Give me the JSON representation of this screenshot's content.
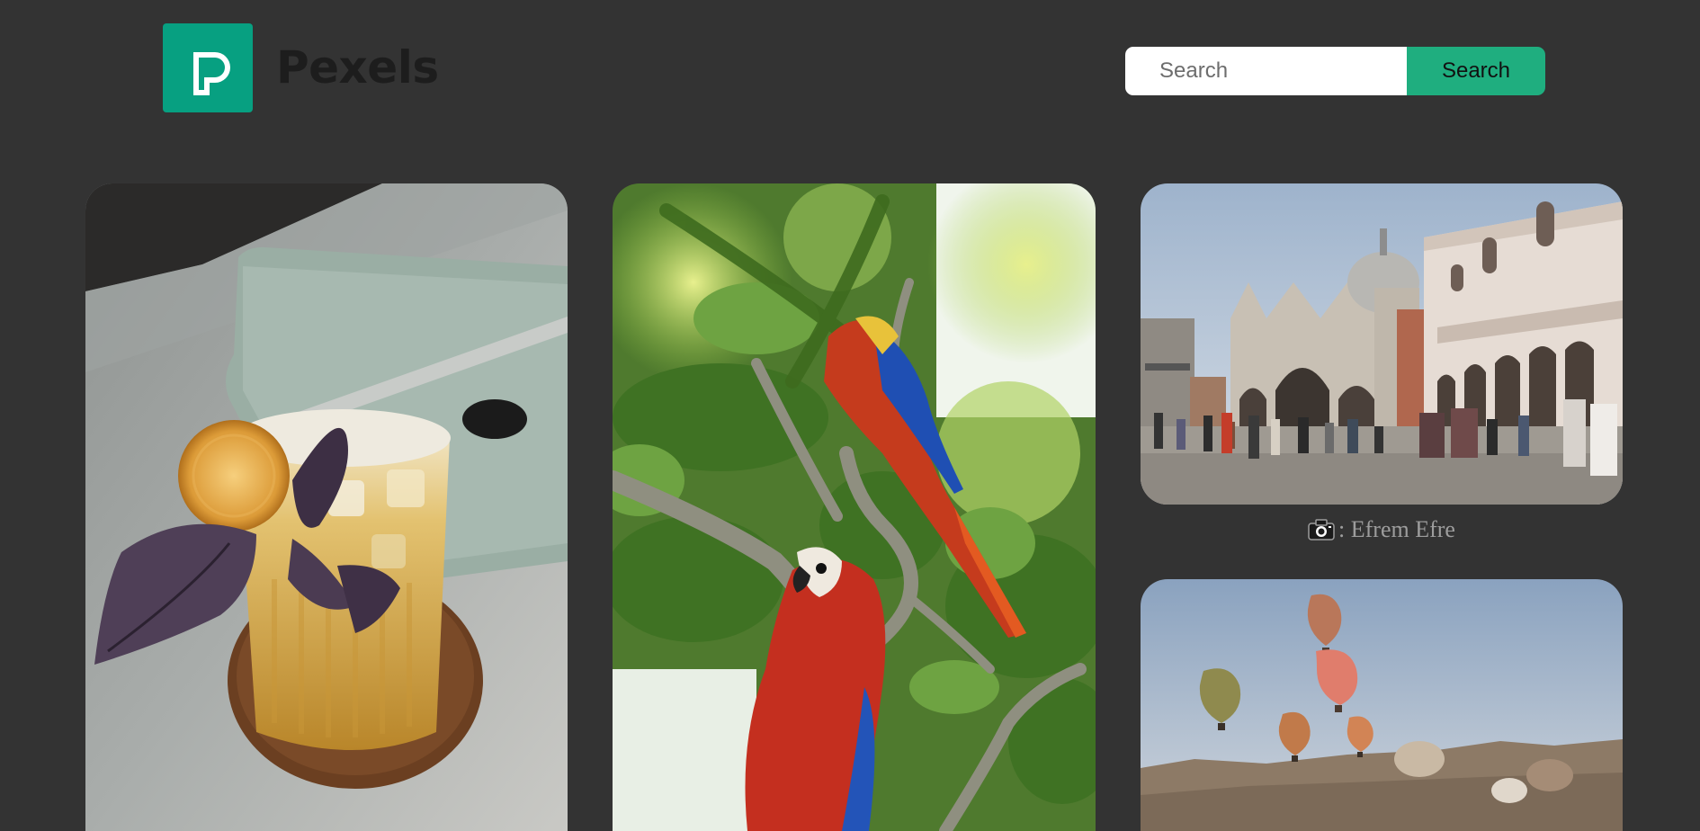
{
  "header": {
    "brand_name": "Pexels",
    "logo_icon": "pexels-logo-icon",
    "search": {
      "placeholder": "Search",
      "button_label": "Search"
    }
  },
  "gallery": {
    "photos": [
      {
        "subject": "cocktail-photo"
      },
      {
        "subject": "parrots-photo"
      },
      {
        "subject": "venice-photo",
        "credit": ": Efrem Efre",
        "credit_icon": "camera-icon"
      },
      {
        "subject": "hot-air-balloons-photo"
      }
    ]
  },
  "colors": {
    "background": "#333333",
    "brand_green": "#07a081",
    "button_green": "#1fae7f",
    "credit_text": "#9d9d9d"
  }
}
